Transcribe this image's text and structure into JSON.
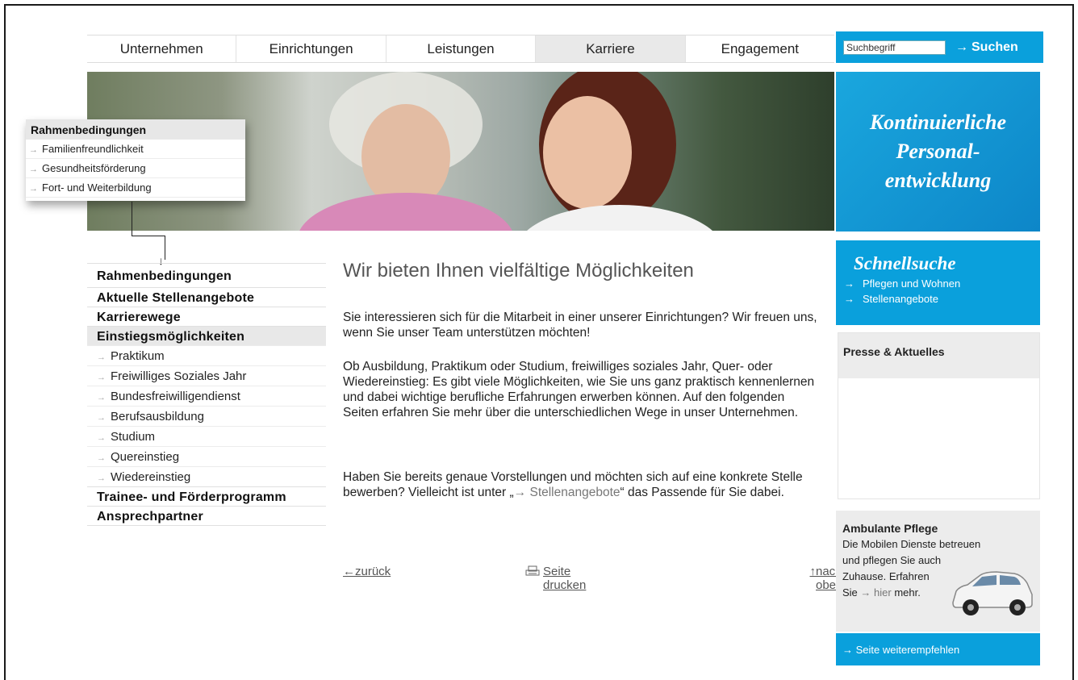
{
  "top_nav": [
    "Unternehmen",
    "Einrichtungen",
    "Leistungen",
    "Karriere",
    "Engagement"
  ],
  "search": {
    "placeholder": "Suchbegriff",
    "button": "Suchen",
    "arrow": "→"
  },
  "hero_claim": [
    "Kontinuierliche",
    "Personal-",
    "entwicklung"
  ],
  "overlay": {
    "title": "Rahmenbedingungen",
    "items": [
      "Familienfreundlichkeit",
      "Gesundheitsförderung",
      "Fort- und Weiterbildung"
    ]
  },
  "left_nav": {
    "main1": "Rahmenbedingungen",
    "main2": "Aktuelle Stellenangebote",
    "main3": "Karrierewege",
    "main4": "Einstiegsmöglichkeiten",
    "sub": [
      "Praktikum",
      "Freiwilliges Soziales Jahr",
      "Bundesfreiwilligendienst",
      "Berufsausbildung",
      "Studium",
      "Quereinstieg",
      "Wiedereinstieg"
    ],
    "main5": "Trainee- und Förderprogramm",
    "main6": "Ansprechpartner"
  },
  "content": {
    "title": "Wir bieten Ihnen vielfältige Möglichkeiten",
    "p1": "Sie interessieren sich für die Mitarbeit in einer unserer Einrichtungen? Wir freuen uns, wenn Sie unser Team unterstützen möchten!",
    "p2": "Ob Ausbildung, Praktikum oder Studium, freiwilliges soziales Jahr, Quer- oder Wiedereinstieg: Es gibt viele Möglichkeiten, wie Sie uns ganz praktisch kennenlernen und dabei wichtige berufliche Erfahrungen erwerben können. Auf den folgenden Seiten erfahren Sie mehr über die unterschiedlichen Wege in unser Unternehmen.",
    "p3_before": "Haben Sie bereits genaue Vorstellungen und möchten sich auf eine konkrete Stelle bewerben? Vielleicht ist unter „",
    "p3_link": "→ Stellenangebote",
    "p3_after": "“ das Passende für Sie dabei."
  },
  "bottom_links": {
    "back": "zurück",
    "print": "Seite drucken",
    "top": "nach oben"
  },
  "quick": {
    "title": "Schnellsuche",
    "links": [
      "Pflegen und Wohnen",
      "Stellenangebote"
    ]
  },
  "news": {
    "title": "Presse & Aktuelles"
  },
  "ambulant": {
    "title": "Ambulante Pflege",
    "l1": "Die Mobilen Dienste betreuen",
    "l2": "und pflegen Sie auch",
    "l3": "Zuhause. Erfahren",
    "l4_pre": "Sie",
    "hier": "→ hier",
    "l4_post": "mehr."
  },
  "recommend": "→ Seite weiterempfehlen",
  "colors": {
    "accent": "#0aa0dc"
  }
}
